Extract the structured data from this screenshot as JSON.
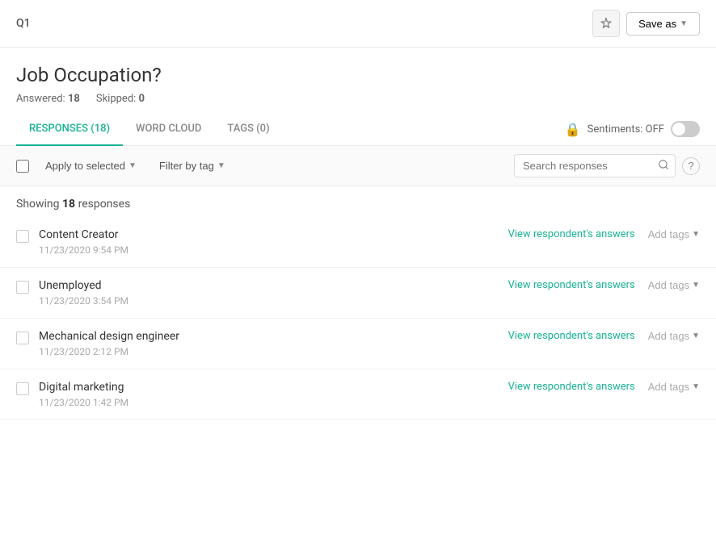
{
  "header": {
    "question_label": "Q1",
    "save_button": "Save as",
    "pin_icon": "📌"
  },
  "question": {
    "title": "Job Occupation?",
    "answered_label": "Answered:",
    "answered_count": "18",
    "skipped_label": "Skipped:",
    "skipped_count": "0"
  },
  "tabs": [
    {
      "id": "responses",
      "label": "RESPONSES (18)",
      "active": true
    },
    {
      "id": "wordcloud",
      "label": "WORD CLOUD",
      "active": false
    },
    {
      "id": "tags",
      "label": "TAGS (0)",
      "active": false
    }
  ],
  "sentiments": {
    "label": "Sentiments: OFF"
  },
  "toolbar": {
    "apply_label": "Apply to selected",
    "filter_label": "Filter by tag",
    "search_placeholder": "Search responses"
  },
  "showing": {
    "prefix": "Showing",
    "count": "18",
    "suffix": "responses"
  },
  "responses": [
    {
      "text": "Content Creator",
      "date": "11/23/2020 9:54 PM",
      "view_link": "View respondent's answers",
      "add_tags": "Add tags"
    },
    {
      "text": "Unemployed",
      "date": "11/23/2020 3:54 PM",
      "view_link": "View respondent's answers",
      "add_tags": "Add tags"
    },
    {
      "text": "Mechanical design engineer",
      "date": "11/23/2020 2:12 PM",
      "view_link": "View respondent's answers",
      "add_tags": "Add tags"
    },
    {
      "text": "Digital marketing",
      "date": "11/23/2020 1:42 PM",
      "view_link": "View respondent's answers",
      "add_tags": "Add tags"
    }
  ]
}
